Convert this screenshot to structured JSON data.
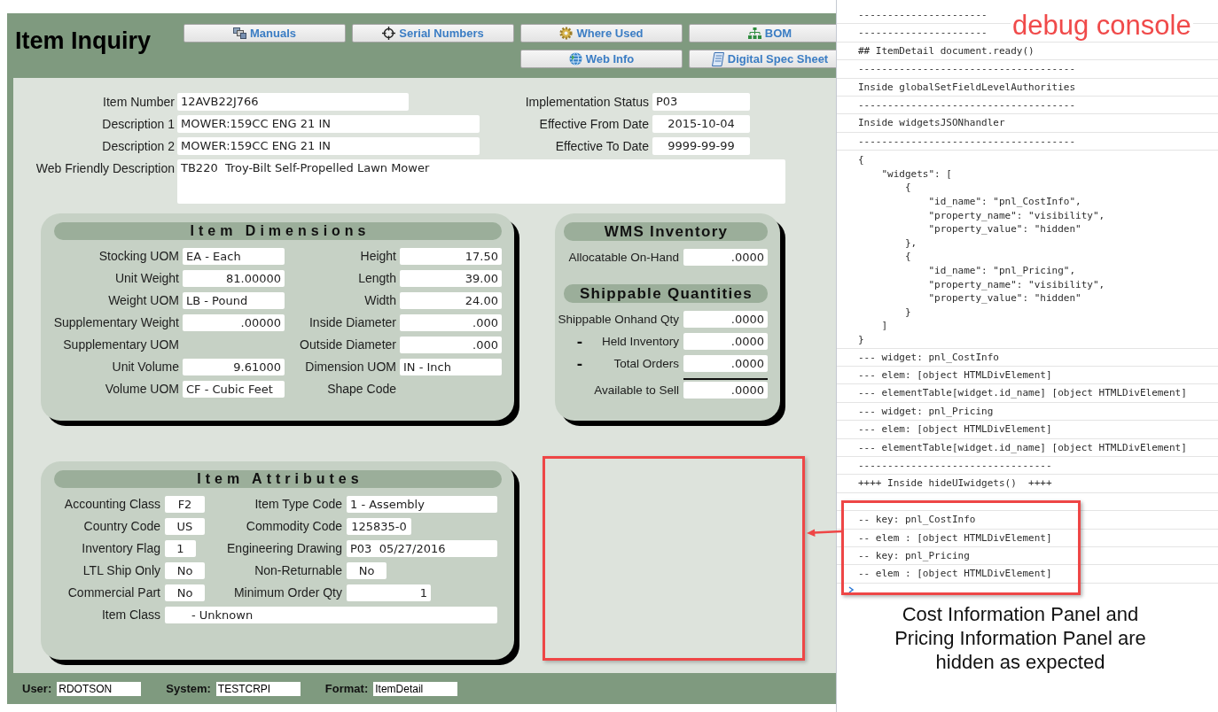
{
  "header": {
    "title": "Item Inquiry",
    "button_rows": [
      [
        "Manuals",
        "Serial Numbers",
        "Where Used",
        "BOM"
      ],
      [
        "Web Info",
        "Digital Spec Sheet"
      ]
    ]
  },
  "item_info": {
    "fields": [
      {
        "label": "Item Number",
        "value": "12AVB22J766",
        "kind": "text"
      },
      {
        "label": "Description 1",
        "value": "MOWER:159CC ENG 21 IN",
        "kind": "text"
      },
      {
        "label": "Description 2",
        "value": "MOWER:159CC ENG 21 IN",
        "kind": "text"
      }
    ],
    "status_fields": [
      {
        "label": "Implementation Status",
        "value": "P03",
        "kind": "text"
      },
      {
        "label": "Effective From Date",
        "value": "2015-10-04",
        "kind": "date"
      },
      {
        "label": "Effective To Date",
        "value": "9999-99-99",
        "kind": "date"
      }
    ],
    "web_description": {
      "label": "Web Friendly Description",
      "value": "TB220  Troy-Bilt Self-Propelled Lawn Mower"
    }
  },
  "item_dimensions": {
    "title": "Item Dimensions",
    "left_fields": [
      {
        "label": "Stocking UOM",
        "value": "EA - Each",
        "kind": "text"
      },
      {
        "label": "Unit Weight",
        "value": "81.00000",
        "kind": "number"
      },
      {
        "label": "Weight UOM",
        "value": "LB - Pound",
        "kind": "text"
      },
      {
        "label": "Supplementary Weight",
        "value": ".00000",
        "kind": "number"
      },
      {
        "label": "Supplementary UOM"
      },
      {
        "label": "Unit Volume",
        "value": "9.61000",
        "kind": "number"
      },
      {
        "label": "Volume UOM",
        "value": "CF - Cubic Feet",
        "kind": "text"
      }
    ],
    "right_fields": [
      {
        "label": "Height",
        "value": "17.50",
        "kind": "number"
      },
      {
        "label": "Length",
        "value": "39.00",
        "kind": "number"
      },
      {
        "label": "Width",
        "value": "24.00",
        "kind": "number"
      },
      {
        "label": "Inside Diameter",
        "value": ".000",
        "kind": "number"
      },
      {
        "label": "Outside Diameter",
        "value": ".000",
        "kind": "number"
      },
      {
        "label": "Dimension UOM",
        "value": "IN - Inch",
        "kind": "text"
      },
      {
        "label": "Shape Code"
      }
    ]
  },
  "wms_panel": {
    "sections": [
      {
        "title": "WMS Inventory",
        "fields": [
          {
            "label": "Allocatable On-Hand",
            "value": ".0000",
            "kind": "number",
            "total": false
          }
        ]
      },
      {
        "title": "Shippable Quantities",
        "fields": [
          {
            "label": "Shippable Onhand Qty",
            "value": ".0000",
            "kind": "number",
            "total": false
          },
          {
            "sign": "-",
            "label": "Held Inventory",
            "value": ".0000",
            "kind": "number",
            "total": false
          },
          {
            "sign": "-",
            "label": "Total Orders",
            "value": ".0000",
            "kind": "number",
            "total": false
          },
          {
            "label": "Available to Sell",
            "value": ".0000",
            "kind": "number",
            "total": true
          }
        ]
      }
    ]
  },
  "item_attributes": {
    "title": "Item Attributes",
    "left_fields": [
      {
        "label": "Accounting Class",
        "value": "F2",
        "kind": "code"
      },
      {
        "label": "Country Code",
        "value": "US",
        "kind": "code"
      },
      {
        "label": "Inventory Flag",
        "value": "1",
        "kind": "code"
      },
      {
        "label": "LTL Ship Only",
        "value": "No",
        "kind": "code"
      },
      {
        "label": "Commercial Part",
        "value": "No",
        "kind": "code"
      }
    ],
    "right_fields": [
      {
        "label": "Item Type Code",
        "value": "1 - Assembly",
        "kind": "text"
      },
      {
        "label": "Commodity Code",
        "value": "125835-0",
        "kind": "code"
      },
      {
        "label": "Engineering Drawing",
        "value": "P03  05/27/2016",
        "kind": "text"
      },
      {
        "label": "Non-Returnable",
        "value": "No",
        "kind": "code"
      },
      {
        "label": "Minimum Order Qty",
        "value": "1",
        "kind": "number"
      }
    ],
    "item_class": {
      "label": "Item Class",
      "value": "- Unknown"
    }
  },
  "status_bar": [
    {
      "label": "User:",
      "value": "RDOTSON"
    },
    {
      "label": "System:",
      "value": "TESTCRPI"
    },
    {
      "label": "Format:",
      "value": "ItemDetail"
    }
  ],
  "console": {
    "entries": [
      {
        "kind": "line",
        "text": "----------------------"
      },
      {
        "kind": "line",
        "text": "----------------------"
      },
      {
        "kind": "line",
        "text": "## ItemDetail document.ready()"
      },
      {
        "kind": "line",
        "text": "-------------------------------------"
      },
      {
        "kind": "line",
        "text": "Inside globalSetFieldLevelAuthorities"
      },
      {
        "kind": "line",
        "text": "-------------------------------------"
      },
      {
        "kind": "line",
        "text": "Inside widgetsJSONhandler"
      },
      {
        "kind": "line",
        "text": "-------------------------------------"
      },
      {
        "kind": "block",
        "text": "{\n    \"widgets\": [\n        {\n            \"id_name\": \"pnl_CostInfo\",\n            \"property_name\": \"visibility\",\n            \"property_value\": \"hidden\"\n        },\n        {\n            \"id_name\": \"pnl_Pricing\",\n            \"property_name\": \"visibility\",\n            \"property_value\": \"hidden\"\n        }\n    ]\n}"
      },
      {
        "kind": "line",
        "text": "--- widget: pnl_CostInfo"
      },
      {
        "kind": "line",
        "text": "--- elem: [object HTMLDivElement]"
      },
      {
        "kind": "line",
        "text": "--- elementTable[widget.id_name] [object HTMLDivElement]"
      },
      {
        "kind": "line",
        "text": "--- widget: pnl_Pricing"
      },
      {
        "kind": "line",
        "text": "--- elem: [object HTMLDivElement]"
      },
      {
        "kind": "line",
        "text": "--- elementTable[widget.id_name] [object HTMLDivElement]"
      },
      {
        "kind": "line",
        "text": "---------------------------------"
      },
      {
        "kind": "line",
        "text": "++++ Inside hideUIwidgets()  ++++"
      }
    ],
    "highlighted_entries": [
      "-- key: pnl_CostInfo",
      "-- elem : [object HTMLDivElement]",
      "-- key: pnl_Pricing",
      "-- elem : [object HTMLDivElement]"
    ]
  },
  "annotations": {
    "title": "debug console",
    "caption": "Cost Information Panel and Pricing Information Panel are hidden as expected"
  }
}
